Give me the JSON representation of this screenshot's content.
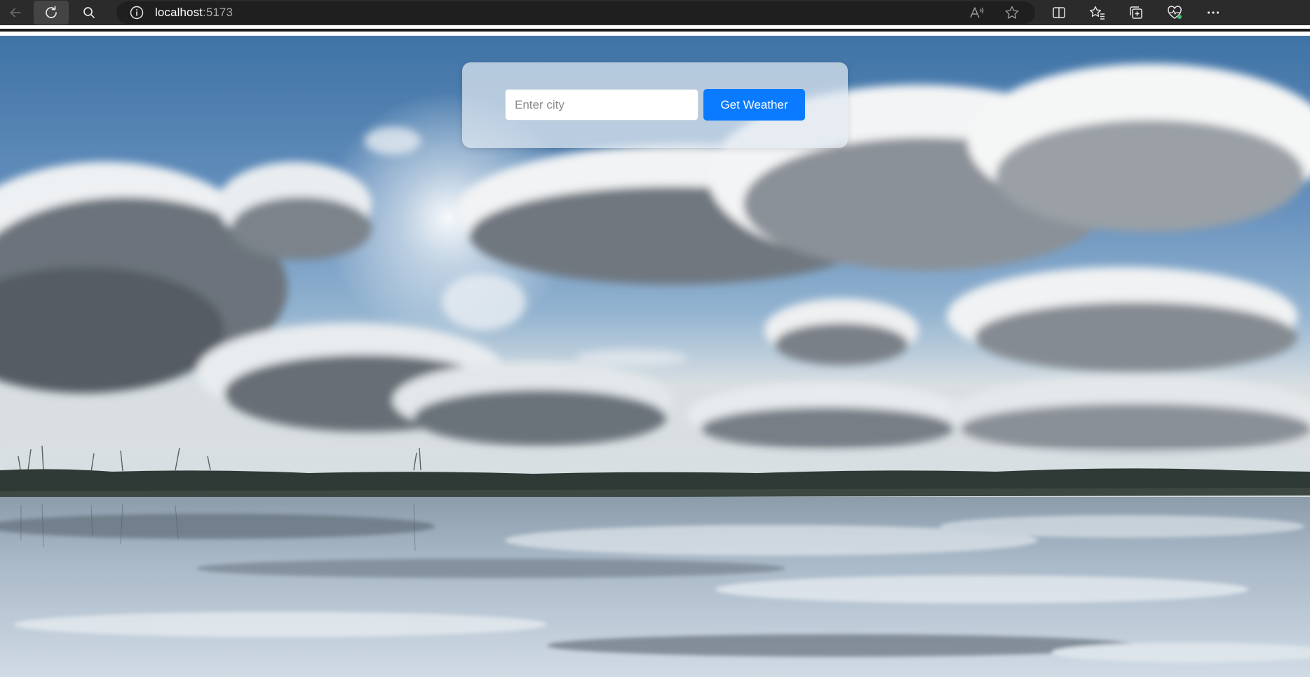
{
  "browser": {
    "url_host": "localhost",
    "url_port": ":5173",
    "icons": {
      "back": "back-arrow-icon",
      "reload": "reload-icon",
      "search": "search-icon",
      "site_info": "info-icon",
      "read_aloud": "read-aloud-icon",
      "favorite": "star-icon",
      "split_screen": "split-screen-icon",
      "favorites": "favorites-icon",
      "collections": "collections-icon",
      "browser_essentials": "heart-pulse-icon",
      "more": "more-icon"
    }
  },
  "weather_form": {
    "city_placeholder": "Enter city",
    "city_value": "",
    "submit_label": "Get Weather"
  },
  "colors": {
    "button": "#0a7bff",
    "card": "rgba(225,233,241,0.72)",
    "chrome": "#2b2b2b"
  }
}
